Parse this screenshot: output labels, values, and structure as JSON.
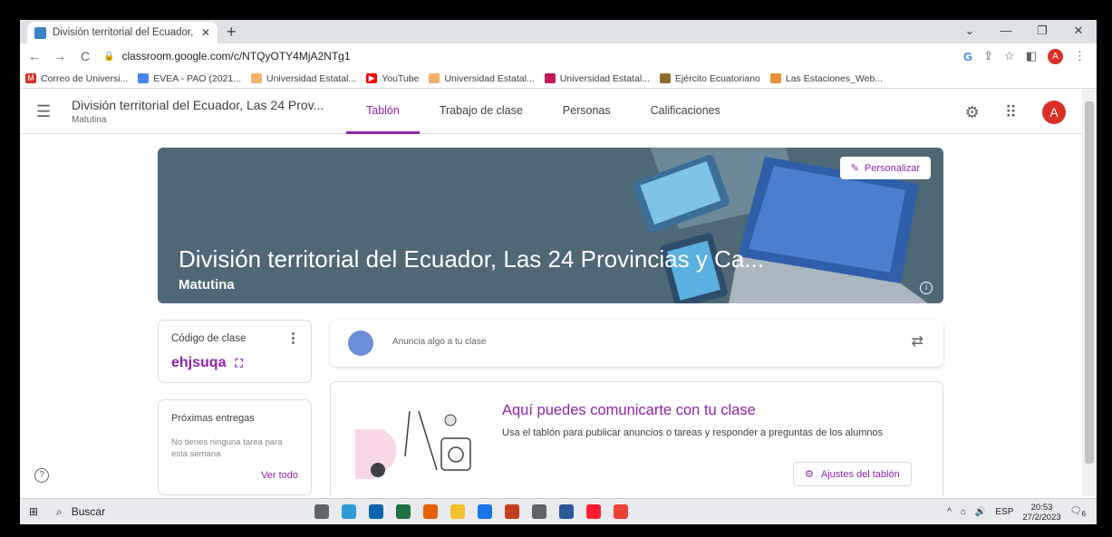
{
  "browser": {
    "tab_title": "División territorial del Ecuador, Li",
    "tab_close": "✕",
    "new_tab": "+",
    "url": "classroom.google.com/c/NTQyOTY4MjA2NTg1",
    "window_controls": [
      "⌄",
      "—",
      "❐",
      "✕"
    ],
    "profile_initial": "A"
  },
  "bookmarks": [
    {
      "label": "Correo de Universi...",
      "color": "#d93025",
      "glyph": "M"
    },
    {
      "label": "EVEA - PAO (2021...",
      "color": "#4285f4",
      "glyph": ""
    },
    {
      "label": "Universidad Estatal...",
      "color": "#f6b26b",
      "glyph": ""
    },
    {
      "label": "YouTube",
      "color": "#ff0000",
      "glyph": "▶"
    },
    {
      "label": "Universidad Estatal...",
      "color": "#f6b26b",
      "glyph": ""
    },
    {
      "label": "Universidad Estatal...",
      "color": "#c2185b",
      "glyph": ""
    },
    {
      "label": "Ejército Ecuatoriano",
      "color": "#8e6e2e",
      "glyph": ""
    },
    {
      "label": "Las Estaciones_Web...",
      "color": "#e69138",
      "glyph": ""
    }
  ],
  "header": {
    "title": "División territorial del Ecuador, Las 24 Prov...",
    "subtitle": "Matutina",
    "tabs": [
      "Tablón",
      "Trabajo de clase",
      "Personas",
      "Calificaciones"
    ],
    "active_tab": 0,
    "avatar_initial": "A"
  },
  "banner": {
    "title": "División territorial del Ecuador, Las 24 Provincias y Ca...",
    "subtitle": "Matutina",
    "customize_label": "Personalizar"
  },
  "class_code": {
    "label": "Código de clase",
    "value": "ehjsuqa"
  },
  "upcoming": {
    "title": "Próximas entregas",
    "empty_text": "No tienes ninguna tarea para esta semana",
    "link": "Ver todo"
  },
  "announce": {
    "placeholder": "Anuncia algo a tu clase"
  },
  "communicate": {
    "title": "Aquí puedes comunicarte con tu clase",
    "description": "Usa el tablón para publicar anuncios o tareas y responder a preguntas de los alumnos",
    "button": "Ajustes del tablón"
  },
  "taskbar": {
    "search_label": "Buscar",
    "apps": [
      {
        "name": "task-view",
        "color": "#5f6368"
      },
      {
        "name": "edge",
        "color": "#2e9bd6"
      },
      {
        "name": "mail",
        "color": "#0a64ad"
      },
      {
        "name": "excel",
        "color": "#1d6f42"
      },
      {
        "name": "firefox",
        "color": "#e66000"
      },
      {
        "name": "explorer",
        "color": "#f2c12e"
      },
      {
        "name": "headset",
        "color": "#1a73e8"
      },
      {
        "name": "powerpoint",
        "color": "#c43e1c"
      },
      {
        "name": "camera",
        "color": "#5f6368"
      },
      {
        "name": "word",
        "color": "#2b579a"
      },
      {
        "name": "opera",
        "color": "#ff1b2d"
      },
      {
        "name": "chrome",
        "color": "#ea4335"
      }
    ],
    "language": "ESP",
    "time": "20:53",
    "date": "27/2/2023",
    "notifications": "6"
  },
  "colors": {
    "accent": "#8e24aa",
    "banner": "#4f6876"
  }
}
